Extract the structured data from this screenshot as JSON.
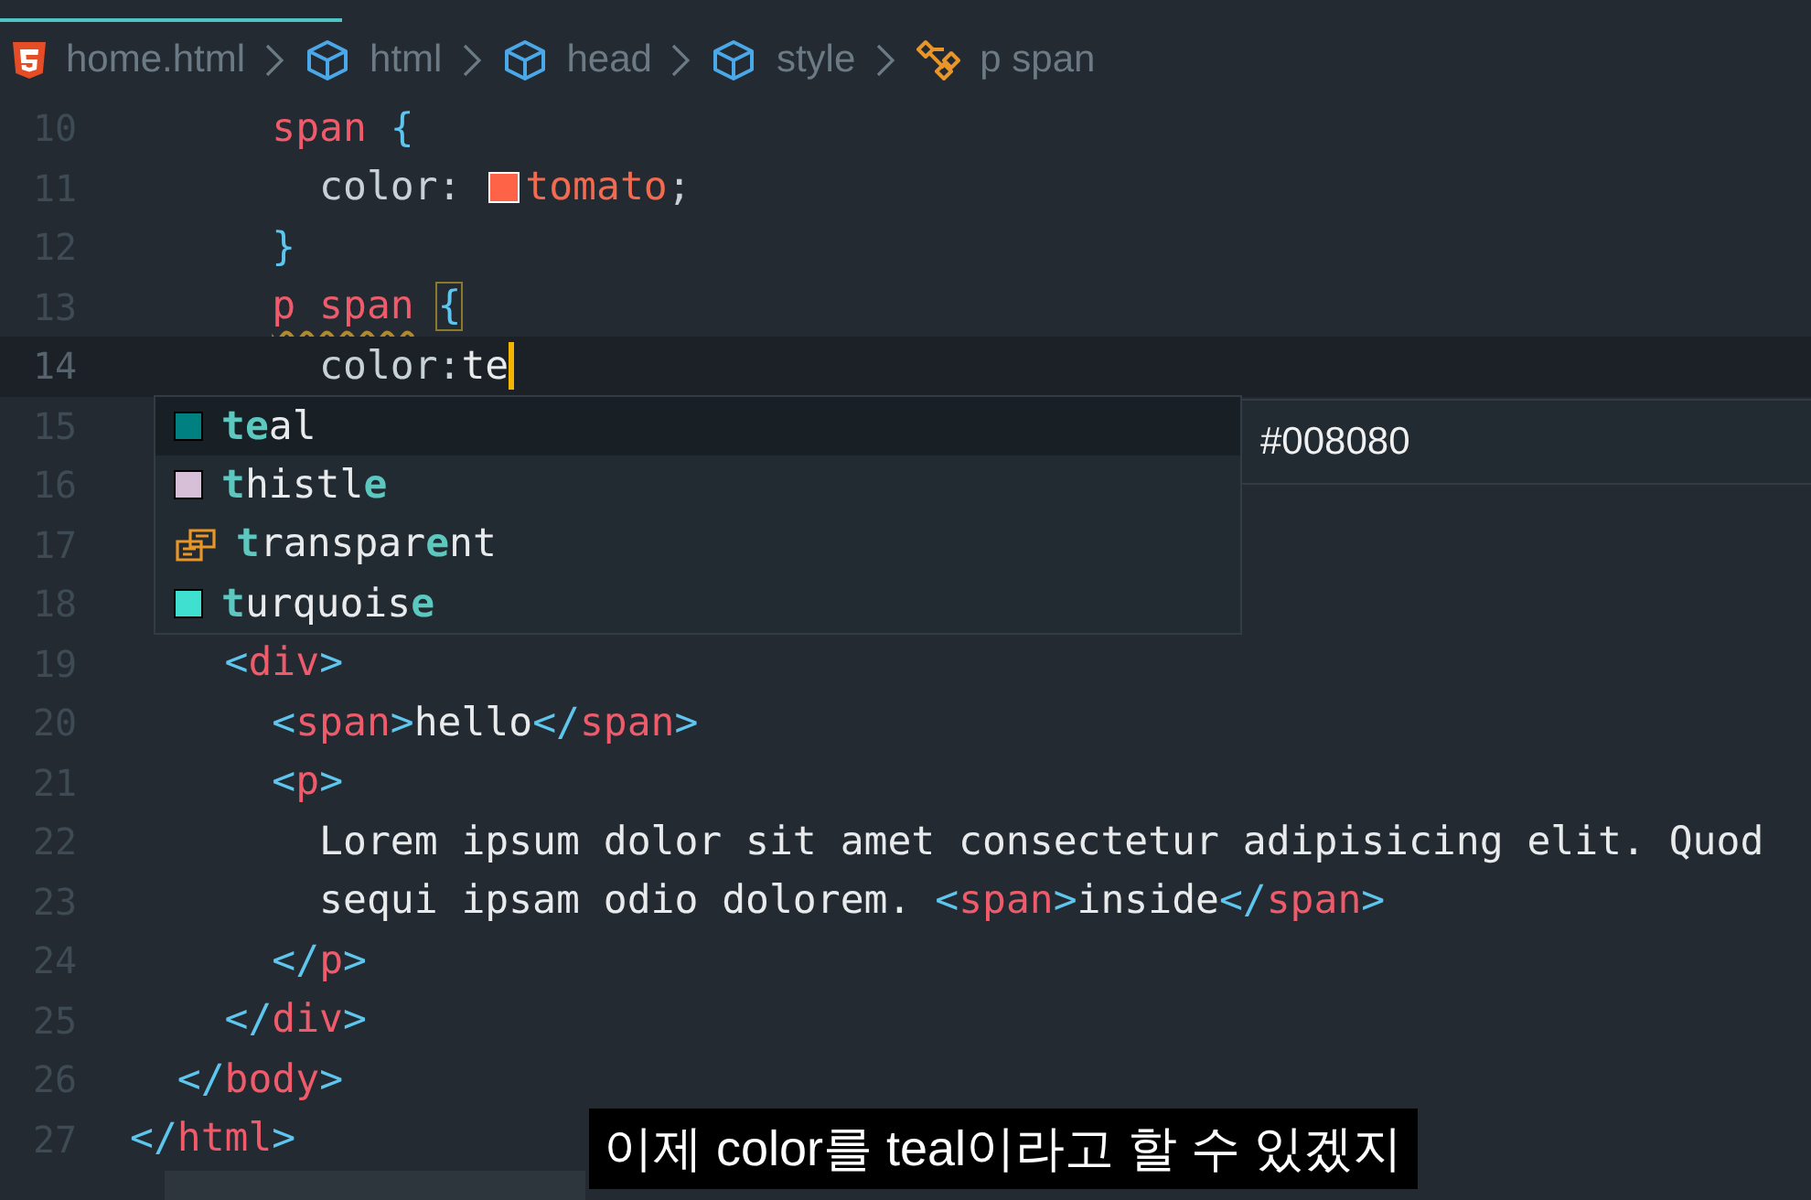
{
  "breadcrumb": [
    {
      "kind": "file",
      "label": "home.html"
    },
    {
      "kind": "element",
      "label": "html"
    },
    {
      "kind": "element",
      "label": "head"
    },
    {
      "kind": "element",
      "label": "style"
    },
    {
      "kind": "selector",
      "label": "p span"
    }
  ],
  "lines": [
    {
      "number": "10",
      "current": false,
      "tokens": [
        {
          "kind": "selector",
          "text": "      span "
        },
        {
          "kind": "punct",
          "text": "{"
        }
      ]
    },
    {
      "number": "11",
      "current": false,
      "tokens": [
        {
          "kind": "property",
          "text": "        color: "
        },
        {
          "kind": "swatch",
          "color": "#ff6347"
        },
        {
          "kind": "value",
          "text": "tomato"
        },
        {
          "kind": "property",
          "text": ";"
        }
      ]
    },
    {
      "number": "12",
      "current": false,
      "tokens": [
        {
          "kind": "punct",
          "text": "      }"
        }
      ]
    },
    {
      "number": "13",
      "current": false,
      "tokens": [
        {
          "kind": "selector",
          "text": "      p span",
          "warning": true
        },
        {
          "kind": "punct",
          "text": " {",
          "matched": true
        }
      ]
    },
    {
      "number": "14",
      "current": true,
      "tokens": [
        {
          "kind": "property",
          "text": "        color:"
        },
        {
          "kind": "text",
          "text": "te"
        },
        {
          "kind": "cursor"
        }
      ]
    },
    {
      "number": "15",
      "current": false
    },
    {
      "number": "16",
      "current": false
    },
    {
      "number": "17",
      "current": false
    },
    {
      "number": "18",
      "current": false
    },
    {
      "number": "19",
      "current": false,
      "tokens": [
        {
          "kind": "punct",
          "text": "    <"
        },
        {
          "kind": "tag",
          "text": "div"
        },
        {
          "kind": "punct",
          "text": ">"
        }
      ]
    },
    {
      "number": "20",
      "current": false,
      "tokens": [
        {
          "kind": "punct",
          "text": "      <"
        },
        {
          "kind": "tag",
          "text": "span"
        },
        {
          "kind": "punct",
          "text": ">"
        },
        {
          "kind": "text",
          "text": "hello"
        },
        {
          "kind": "punct",
          "text": "</"
        },
        {
          "kind": "tag",
          "text": "span"
        },
        {
          "kind": "punct",
          "text": ">"
        }
      ]
    },
    {
      "number": "21",
      "current": false,
      "tokens": [
        {
          "kind": "punct",
          "text": "      <"
        },
        {
          "kind": "tag",
          "text": "p"
        },
        {
          "kind": "punct",
          "text": ">"
        }
      ]
    },
    {
      "number": "22",
      "current": false,
      "tokens": [
        {
          "kind": "text",
          "text": "        Lorem ipsum dolor sit amet consectetur adipisicing elit. Quod"
        }
      ]
    },
    {
      "number": "23",
      "current": false,
      "tokens": [
        {
          "kind": "text",
          "text": "        sequi ipsam odio dolorem. "
        },
        {
          "kind": "punct",
          "text": "<"
        },
        {
          "kind": "tag",
          "text": "span"
        },
        {
          "kind": "punct",
          "text": ">"
        },
        {
          "kind": "text",
          "text": "inside"
        },
        {
          "kind": "punct",
          "text": "</"
        },
        {
          "kind": "tag",
          "text": "span"
        },
        {
          "kind": "punct",
          "text": ">"
        }
      ]
    },
    {
      "number": "24",
      "current": false,
      "tokens": [
        {
          "kind": "punct",
          "text": "      </"
        },
        {
          "kind": "tag",
          "text": "p"
        },
        {
          "kind": "punct",
          "text": ">"
        }
      ]
    },
    {
      "number": "25",
      "current": false,
      "tokens": [
        {
          "kind": "punct",
          "text": "    </"
        },
        {
          "kind": "tag",
          "text": "div"
        },
        {
          "kind": "punct",
          "text": ">"
        }
      ]
    },
    {
      "number": "26",
      "current": false,
      "tokens": [
        {
          "kind": "punct",
          "text": "  </"
        },
        {
          "kind": "tag",
          "text": "body"
        },
        {
          "kind": "punct",
          "text": ">"
        }
      ]
    },
    {
      "number": "27",
      "current": false,
      "tokens": [
        {
          "kind": "punct",
          "text": "</"
        },
        {
          "kind": "tag",
          "text": "html"
        },
        {
          "kind": "punct",
          "text": ">"
        }
      ]
    }
  ],
  "suggestions": {
    "items": [
      {
        "kind": "color",
        "color": "#008080",
        "label": "**te**al",
        "selected": true
      },
      {
        "kind": "color",
        "color": "#d8bfd8",
        "label": "**t**histl**e**",
        "selected": false
      },
      {
        "kind": "keyword",
        "label": "**t**ranspar**e**nt",
        "selected": false
      },
      {
        "kind": "color",
        "color": "#40e0d0",
        "label": "**t**urquois**e**",
        "selected": false
      }
    ],
    "detail": "#008080"
  },
  "subtitle": "이제 color를 teal이라고 할 수 있겠지"
}
